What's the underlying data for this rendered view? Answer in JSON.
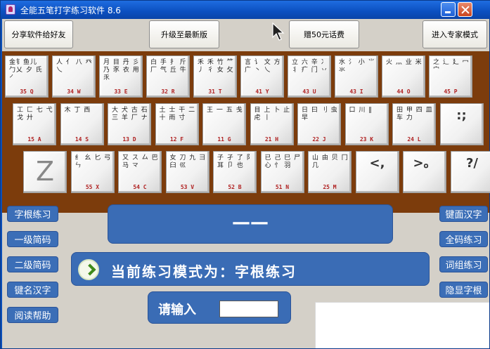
{
  "window": {
    "title": "全能五笔打字练习软件 8.6"
  },
  "toolbar": {
    "share_label": "分享软件给好友",
    "upgrade_label": "升级至最新版",
    "gift_label": "赠50元话费",
    "expert_label": "进入专家模式"
  },
  "keyboard": {
    "row1": [
      {
        "roots": "金钅鱼儿 勹乂 夕 氏 ㇒",
        "code": "35 Q"
      },
      {
        "roots": "人 亻 八 癶 乀",
        "code": "34 W"
      },
      {
        "roots": "月 目 丹 彡 乃 豕 衣 用 乑",
        "code": "33 E"
      },
      {
        "roots": "白 手 扌 斤 厂 气 丘 牛",
        "code": "32 R"
      },
      {
        "roots": "禾 禾 竹 ⺮ 丿 彳 女 攵",
        "code": "31 T"
      },
      {
        "roots": "言 讠 文 方 广 丶 乀",
        "code": "41 Y"
      },
      {
        "roots": "立 六 辛 冫 丬 疒 门 丷",
        "code": "43 U"
      },
      {
        "roots": "水 氵 小 ⺌ 氺",
        "code": "43 I"
      },
      {
        "roots": "火 灬 业 米",
        "code": "44 O"
      },
      {
        "roots": "之 辶 廴 冖 宀",
        "code": "45 P"
      }
    ],
    "row2": [
      {
        "roots": "工 匚 七 弋 戈 廾",
        "code": "15 A"
      },
      {
        "roots": "木 丁 西",
        "code": "14 S"
      },
      {
        "roots": "大 犬 古 石 三 羊 厂 ナ",
        "code": "13 D"
      },
      {
        "roots": "土 士 干 二 十 雨 寸",
        "code": "12 F"
      },
      {
        "roots": "王 一 五 戋",
        "code": "11 G"
      },
      {
        "roots": "目 上 卜 止 虍 丨",
        "code": "21 H"
      },
      {
        "roots": "日 曰 刂 虫 早",
        "code": "22 J"
      },
      {
        "roots": "口 川 ‖",
        "code": "23 K"
      },
      {
        "roots": "田 甲 四 皿 车 力",
        "code": "24 L"
      },
      {
        "sym": ":;"
      }
    ],
    "row3": [
      {
        "z": "Z"
      },
      {
        "roots": "纟 幺 匕 弓 ㄣ",
        "code": "55 X"
      },
      {
        "roots": "又 ス 厶 巴 马 龴",
        "code": "54 C"
      },
      {
        "roots": "女 刀 九 彐 臼 巛",
        "code": "53 V"
      },
      {
        "roots": "子 孑 了 阝 耳 卩 也",
        "code": "52 B"
      },
      {
        "roots": "已 己 巳 尸 心 忄 羽",
        "code": "51 N"
      },
      {
        "roots": "山 由 贝 冂 几",
        "code": "25 M"
      },
      {
        "sym": "<,"
      },
      {
        "sym": ">。"
      },
      {
        "sym": "?/"
      }
    ]
  },
  "left_menu": {
    "items": [
      "字根练习",
      "一级简码",
      "二级简码",
      "键名汉字",
      "阅读帮助"
    ]
  },
  "right_menu": {
    "items": [
      "键面汉字",
      "全码练习",
      "词组练习",
      "隐显字根"
    ]
  },
  "display": {
    "current_char": "——"
  },
  "mode": {
    "text": "当前练习模式为：字根练习"
  },
  "input": {
    "label": "请输入",
    "value": ""
  }
}
